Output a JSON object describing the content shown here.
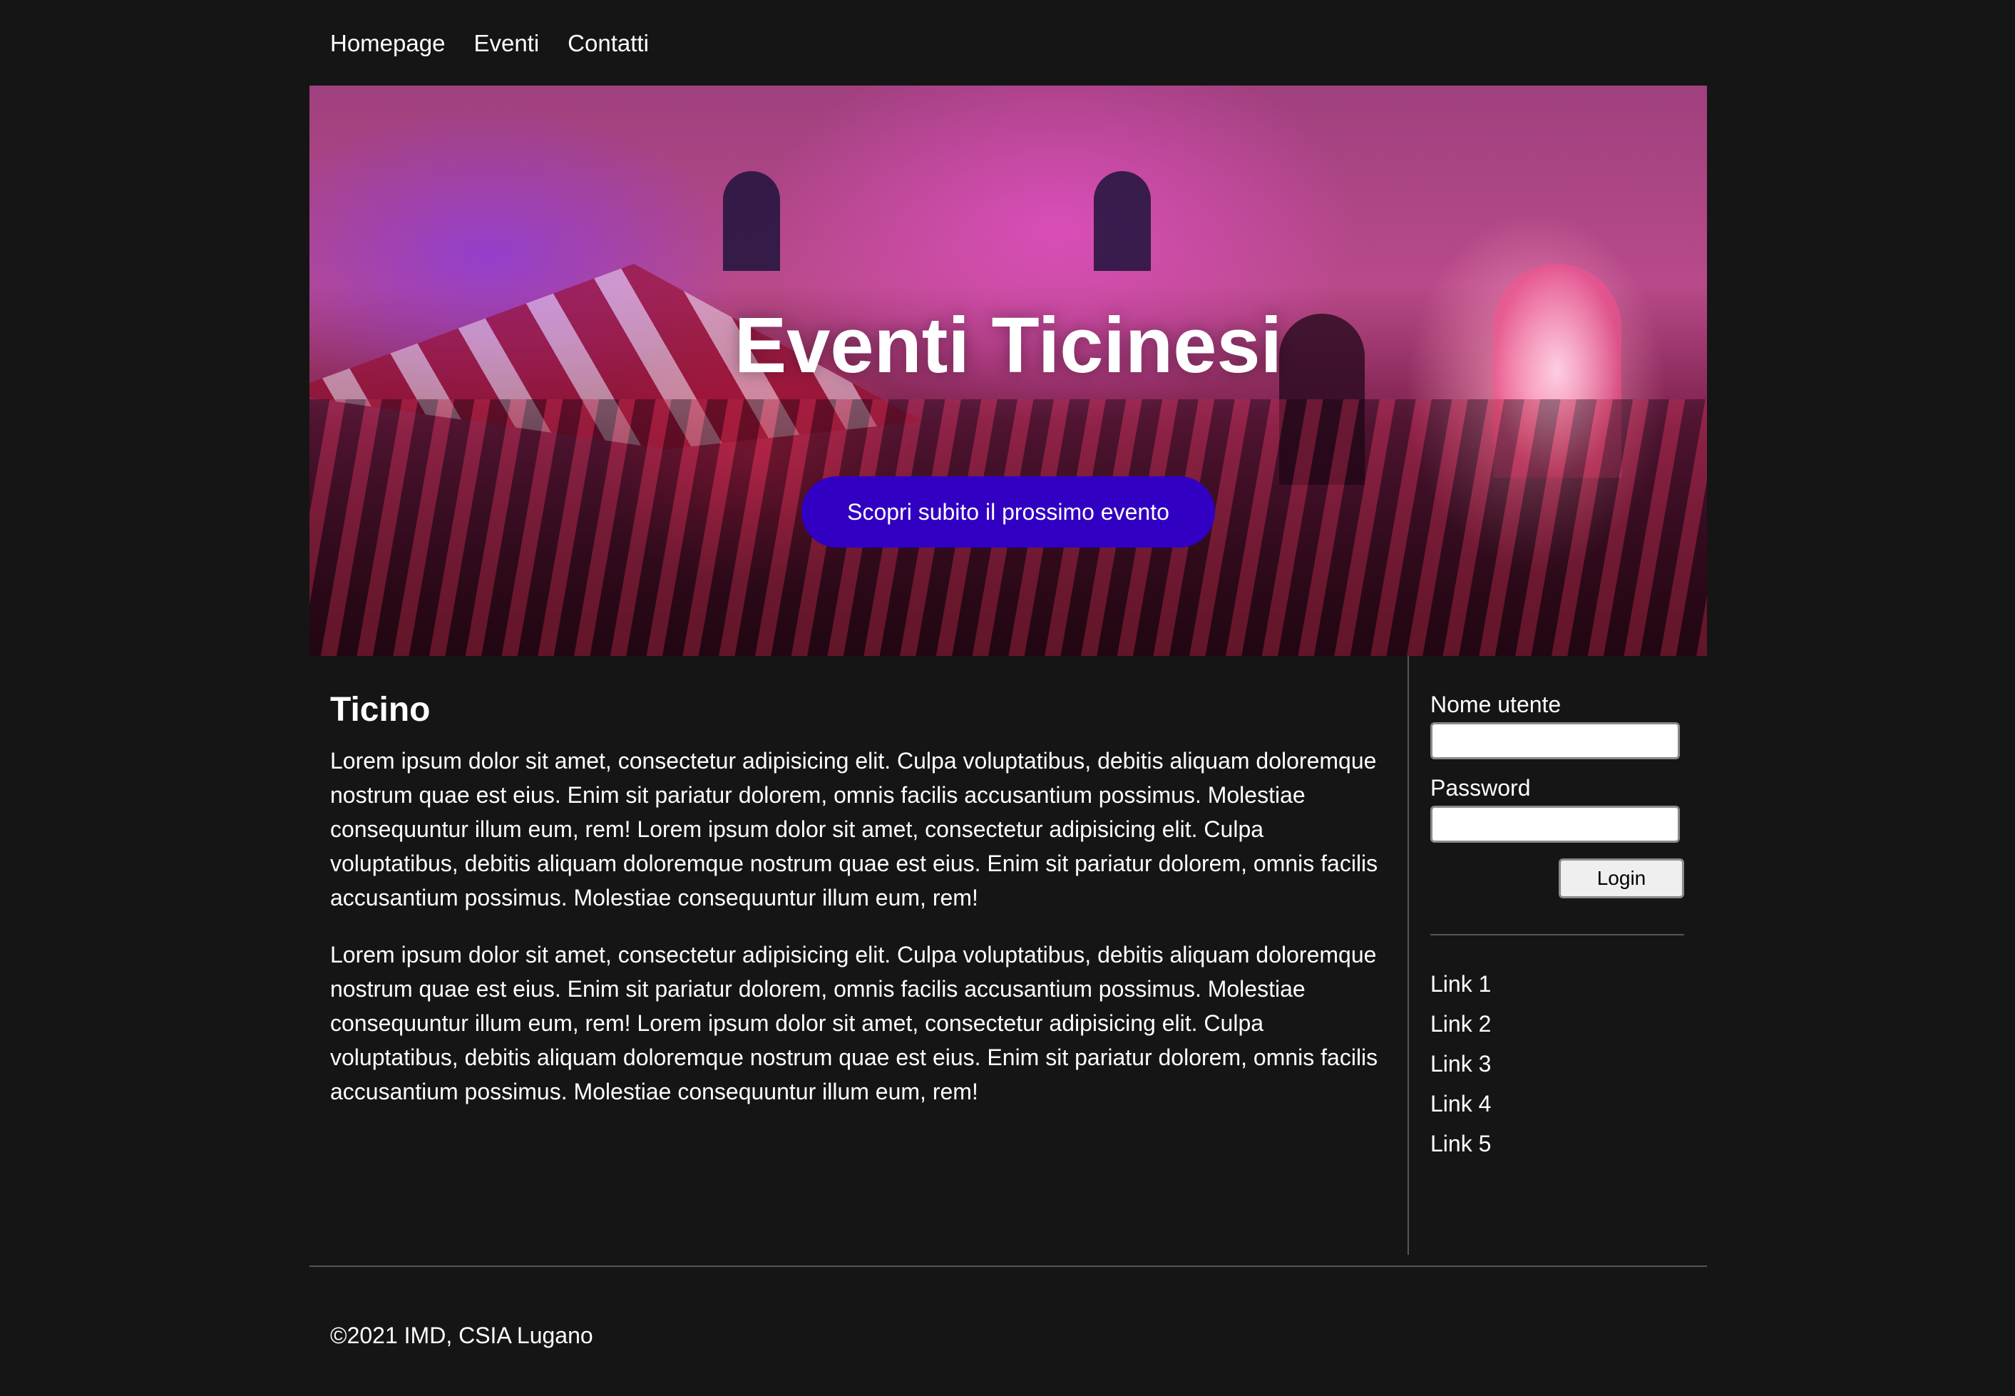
{
  "nav": {
    "items": [
      "Homepage",
      "Eventi",
      "Contatti"
    ]
  },
  "hero": {
    "title": "Eventi Ticinesi",
    "cta_label": "Scopri subito il prossimo evento",
    "accent_color": "#3100c2"
  },
  "main": {
    "heading": "Ticino",
    "paragraphs": [
      "Lorem ipsum dolor sit amet, consectetur adipisicing elit. Culpa voluptatibus, debitis aliquam doloremque nostrum quae est eius. Enim sit pariatur dolorem, omnis facilis accusantium possimus. Molestiae consequuntur illum eum, rem! Lorem ipsum dolor sit amet, consectetur adipisicing elit. Culpa voluptatibus, debitis aliquam doloremque nostrum quae est eius. Enim sit pariatur dolorem, omnis facilis accusantium possimus. Molestiae consequuntur illum eum, rem!",
      "Lorem ipsum dolor sit amet, consectetur adipisicing elit. Culpa voluptatibus, debitis aliquam doloremque nostrum quae est eius. Enim sit pariatur dolorem, omnis facilis accusantium possimus. Molestiae consequuntur illum eum, rem! Lorem ipsum dolor sit amet, consectetur adipisicing elit. Culpa voluptatibus, debitis aliquam doloremque nostrum quae est eius. Enim sit pariatur dolorem, omnis facilis accusantium possimus. Molestiae consequuntur illum eum, rem!"
    ]
  },
  "sidebar": {
    "username_label": "Nome utente",
    "username_value": "",
    "password_label": "Password",
    "password_value": "",
    "login_label": "Login",
    "links": [
      "Link 1",
      "Link 2",
      "Link 3",
      "Link 4",
      "Link 5"
    ]
  },
  "footer": {
    "copyright": "©2021 IMD, CSIA Lugano"
  },
  "colors": {
    "background": "#151515",
    "text": "#ffffff",
    "divider": "#555555"
  }
}
